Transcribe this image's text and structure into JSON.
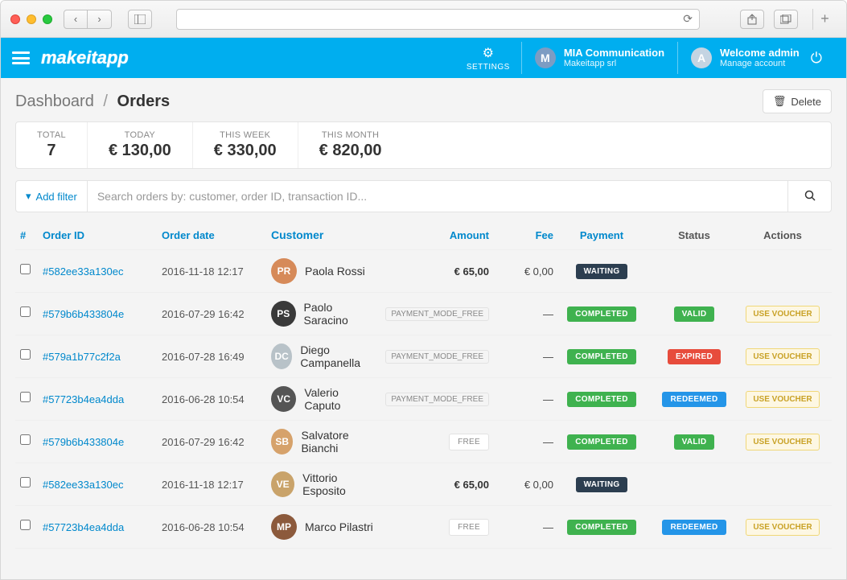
{
  "chrome": {
    "address": ""
  },
  "header": {
    "logo": "makeitapp",
    "settings_label": "SETTINGS",
    "org_initial": "M",
    "org_title": "MIA Communication",
    "org_sub": "Makeitapp srl",
    "user_initial": "A",
    "user_title": "Welcome admin",
    "user_sub": "Manage account"
  },
  "breadcrumb": {
    "root": "Dashboard",
    "current": "Orders"
  },
  "delete_label": "Delete",
  "stats": [
    {
      "label": "TOTAL",
      "value": "7"
    },
    {
      "label": "TODAY",
      "value": "€ 130,00"
    },
    {
      "label": "THIS WEEK",
      "value": "€ 330,00"
    },
    {
      "label": "THIS MONTH",
      "value": "€ 820,00"
    }
  ],
  "filter": {
    "add_label": "Add filter",
    "placeholder": "Search orders by: customer, order ID, transaction ID..."
  },
  "columns": {
    "hash": "#",
    "order_id": "Order ID",
    "order_date": "Order date",
    "customer": "Customer",
    "amount": "Amount",
    "fee": "Fee",
    "payment": "Payment",
    "status": "Status",
    "actions": "Actions"
  },
  "action_button_label": "USE VOUCHER",
  "payment_mode_free_label": "PAYMENT_MODE_FREE",
  "free_label": "FREE",
  "badge_labels": {
    "waiting": "WAITING",
    "completed": "COMPLETED",
    "valid": "VALID",
    "expired": "EXPIRED",
    "redeemed": "REDEEMED"
  },
  "orders": [
    {
      "id": "#582ee33a130ec",
      "date": "2016-11-18 12:17",
      "customer": "Paola Rossi",
      "amount": "€ 65,00",
      "fee": "€ 0,00",
      "payment": "WAITING",
      "status": "",
      "action": "",
      "amount_mode": ""
    },
    {
      "id": "#579b6b433804e",
      "date": "2016-07-29 16:42",
      "customer": "Paolo Saracino",
      "amount": "",
      "fee": "—",
      "payment": "COMPLETED",
      "status": "VALID",
      "action": "USE VOUCHER",
      "amount_mode": "PAYMENT_MODE_FREE"
    },
    {
      "id": "#579a1b77c2f2a",
      "date": "2016-07-28 16:49",
      "customer": "Diego Campanella",
      "amount": "",
      "fee": "—",
      "payment": "COMPLETED",
      "status": "EXPIRED",
      "action": "USE VOUCHER",
      "amount_mode": "PAYMENT_MODE_FREE"
    },
    {
      "id": "#57723b4ea4dda",
      "date": "2016-06-28 10:54",
      "customer": "Valerio Caputo",
      "amount": "",
      "fee": "—",
      "payment": "COMPLETED",
      "status": "REDEEMED",
      "action": "USE VOUCHER",
      "amount_mode": "PAYMENT_MODE_FREE"
    },
    {
      "id": "#579b6b433804e",
      "date": "2016-07-29 16:42",
      "customer": "Salvatore Bianchi",
      "amount": "",
      "fee": "—",
      "payment": "COMPLETED",
      "status": "VALID",
      "action": "USE VOUCHER",
      "amount_mode": "FREE"
    },
    {
      "id": "#582ee33a130ec",
      "date": "2016-11-18 12:17",
      "customer": "Vittorio Esposito",
      "amount": "€ 65,00",
      "fee": "€ 0,00",
      "payment": "WAITING",
      "status": "",
      "action": "",
      "amount_mode": ""
    },
    {
      "id": "#57723b4ea4dda",
      "date": "2016-06-28 10:54",
      "customer": "Marco Pilastri",
      "amount": "",
      "fee": "—",
      "payment": "COMPLETED",
      "status": "REDEEMED",
      "action": "USE VOUCHER",
      "amount_mode": "FREE"
    }
  ],
  "avatar_colors": [
    "#d68a59",
    "#3a3a3a",
    "#b8c2c8",
    "#555555",
    "#d6a26b",
    "#c9a36a",
    "#8c5a3c"
  ]
}
